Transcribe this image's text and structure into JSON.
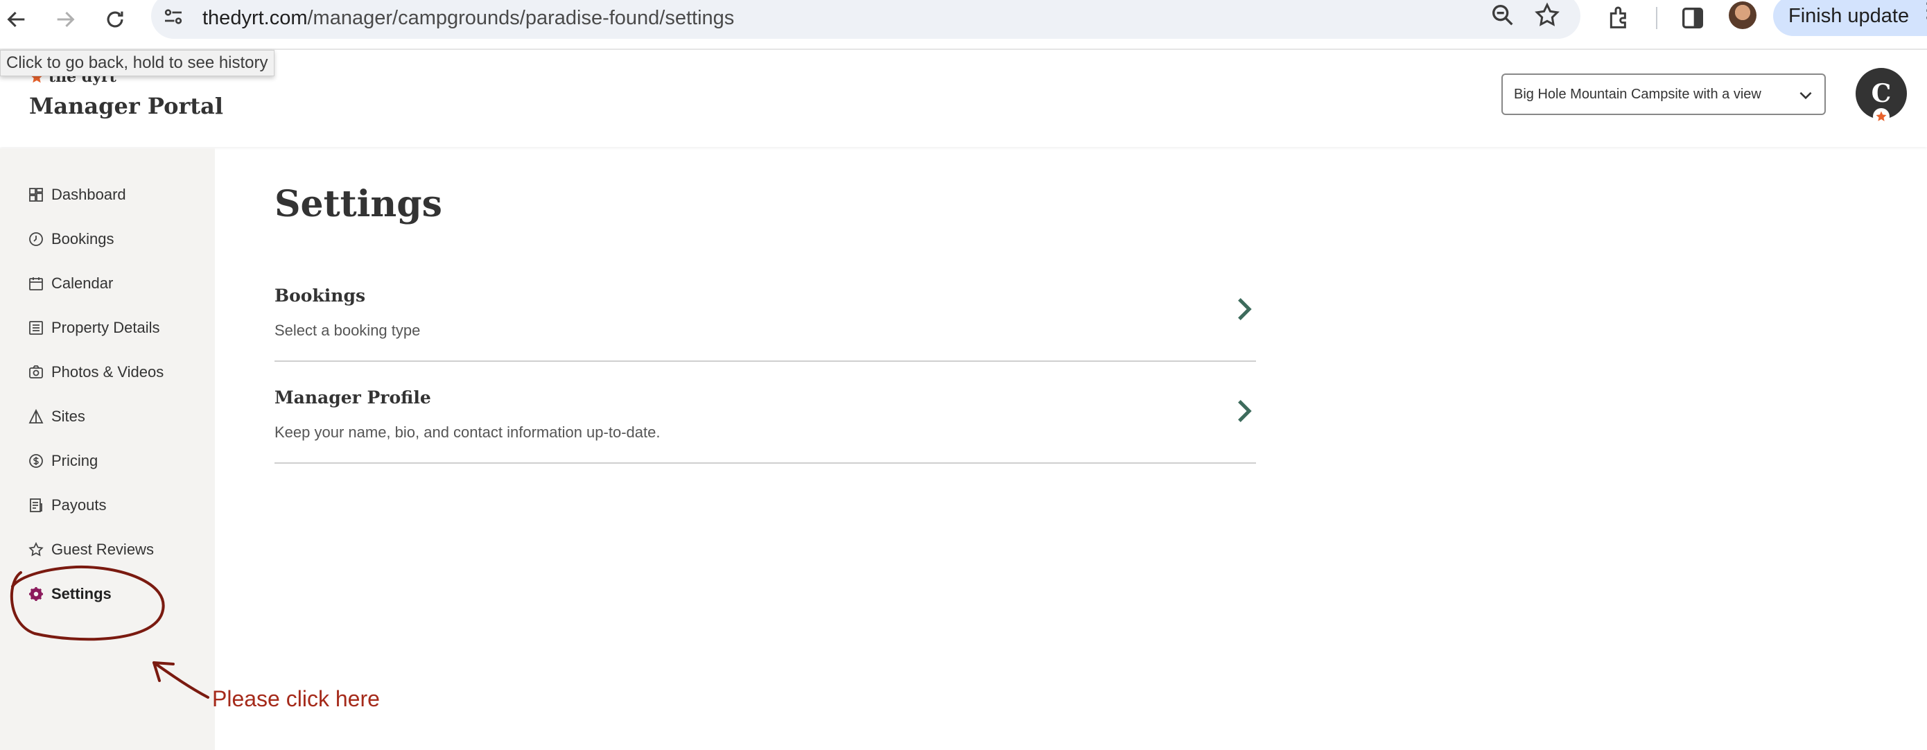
{
  "browser": {
    "url_host": "thedyrt.com",
    "url_path": "/manager/campgrounds/paradise-found/settings",
    "finish_update_label": "Finish update",
    "back_tooltip": "Click to go back, hold to see history"
  },
  "header": {
    "logo_text": "the dyrt",
    "portal_title": "Manager Portal",
    "campground_select_value": "Big Hole Mountain Campsite with a view",
    "user_initial": "C"
  },
  "sidebar": {
    "items": [
      {
        "label": "Dashboard",
        "icon": "dashboard-icon"
      },
      {
        "label": "Bookings",
        "icon": "bookings-icon"
      },
      {
        "label": "Calendar",
        "icon": "calendar-icon"
      },
      {
        "label": "Property Details",
        "icon": "property-details-icon"
      },
      {
        "label": "Photos & Videos",
        "icon": "camera-icon"
      },
      {
        "label": "Sites",
        "icon": "tent-icon"
      },
      {
        "label": "Pricing",
        "icon": "dollar-icon"
      },
      {
        "label": "Payouts",
        "icon": "payouts-icon"
      },
      {
        "label": "Guest Reviews",
        "icon": "star-icon"
      },
      {
        "label": "Settings",
        "icon": "gear-icon",
        "active": true
      }
    ]
  },
  "main": {
    "title": "Settings",
    "rows": [
      {
        "title": "Bookings",
        "description": "Select a booking type"
      },
      {
        "title": "Manager Profile",
        "description": "Keep your name, bio, and contact information up-to-date."
      }
    ]
  },
  "annotation": {
    "text": "Please click here",
    "color": "#a52a1a"
  },
  "colors": {
    "accent_active": "#8b1a5c",
    "chevron": "#3d6b5c",
    "sidebar_bg": "#f4f3f1"
  }
}
